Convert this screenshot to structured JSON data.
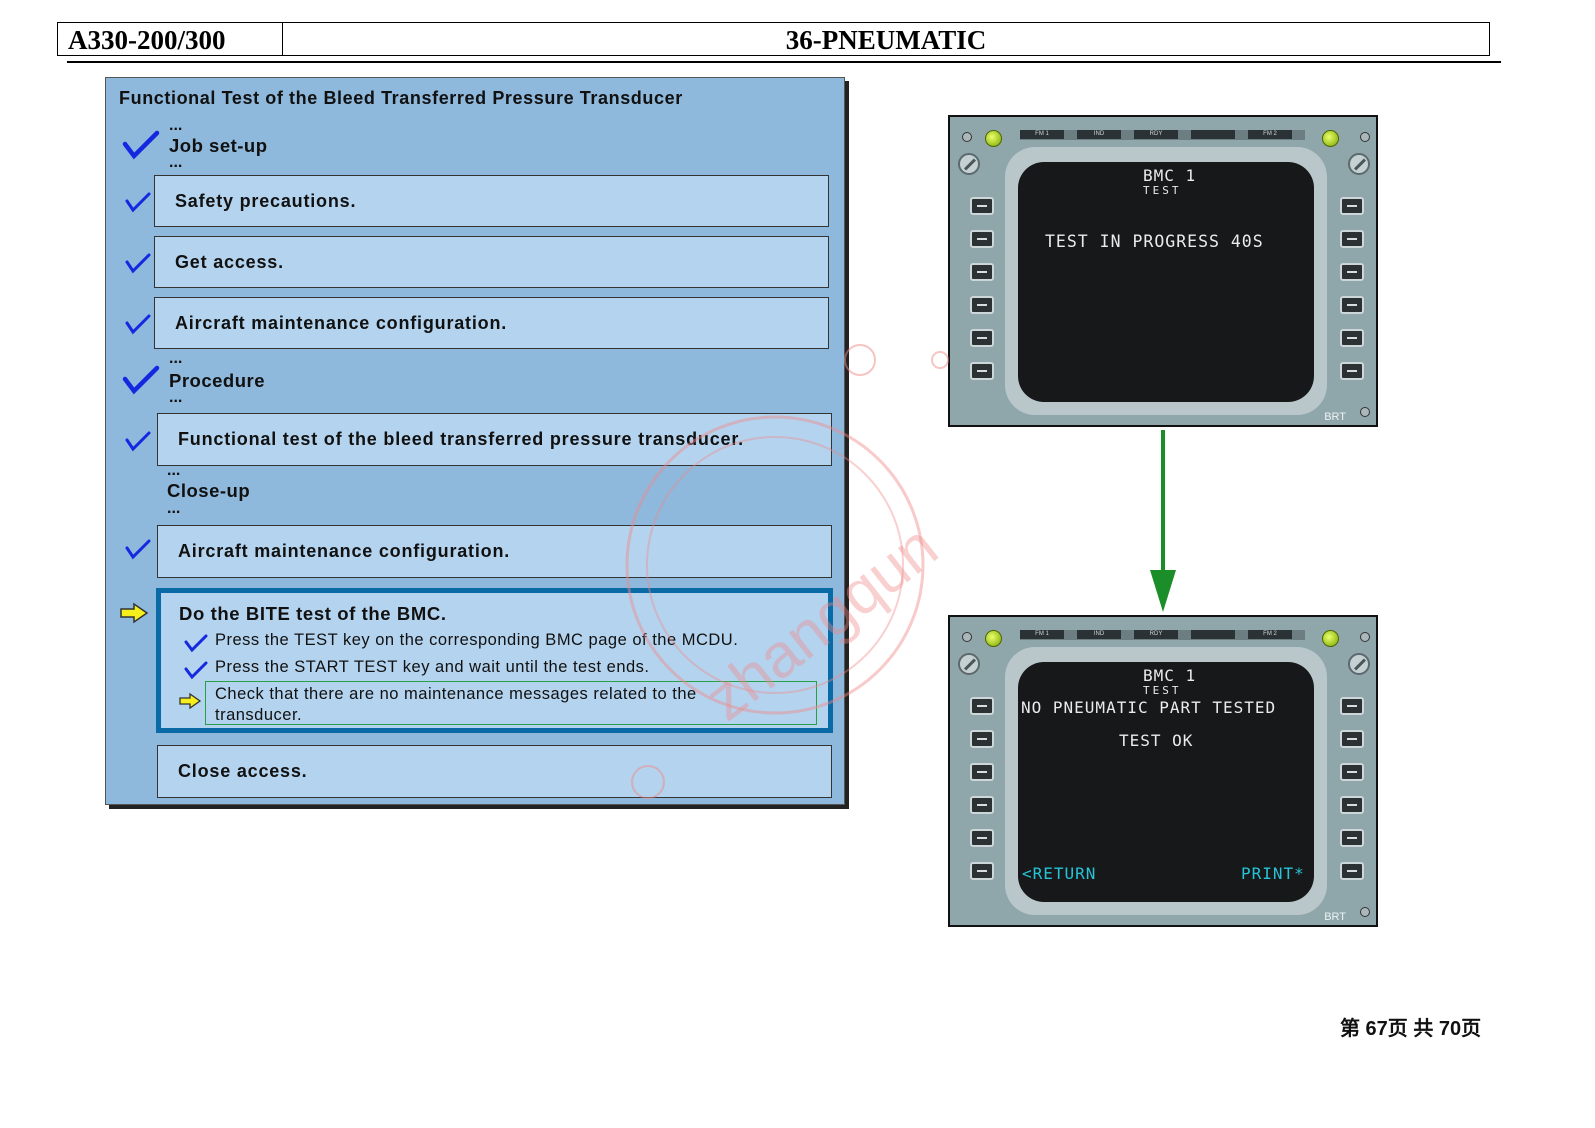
{
  "header": {
    "model": "A330-200/300",
    "chapter": "36-PNEUMATIC"
  },
  "panel": {
    "title": "Functional Test of the Bleed Transferred Pressure Transducer",
    "ellipsis": "...",
    "job_setup": "Job set-up",
    "safety": "Safety precautions.",
    "access": "Get access.",
    "config1": "Aircraft maintenance configuration.",
    "procedure": "Procedure",
    "functional": "Functional test of the bleed transferred pressure transducer.",
    "closeup": "Close-up",
    "config2": "Aircraft maintenance configuration.",
    "bite": {
      "title": "Do the BITE test of the BMC.",
      "step1": "Press the TEST key on the corresponding BMC page of the MCDU.",
      "step2": "Press the START TEST key and wait until the test ends.",
      "step3a": "Check that there are no maintenance messages related to the",
      "step3b": "transducer."
    },
    "close_access": "Close access."
  },
  "mcdu_top": {
    "leds": [
      "FM 1",
      "IND",
      "RDY",
      "",
      "FM 2"
    ],
    "title": "BMC 1",
    "subtitle": "TEST",
    "line1": "TEST IN PROGRESS 40S",
    "brt": "BRT"
  },
  "mcdu_bottom": {
    "leds": [
      "FM 1",
      "IND",
      "RDY",
      "",
      "FM 2"
    ],
    "title": "BMC 1",
    "subtitle": "TEST",
    "line1": "NO PNEUMATIC PART TESTED",
    "line2": "TEST OK",
    "left_key": "<RETURN",
    "right_key": "PRINT*",
    "brt": "BRT"
  },
  "watermark": "zhangqun",
  "footer": {
    "page": "第 67页  共 70页"
  }
}
